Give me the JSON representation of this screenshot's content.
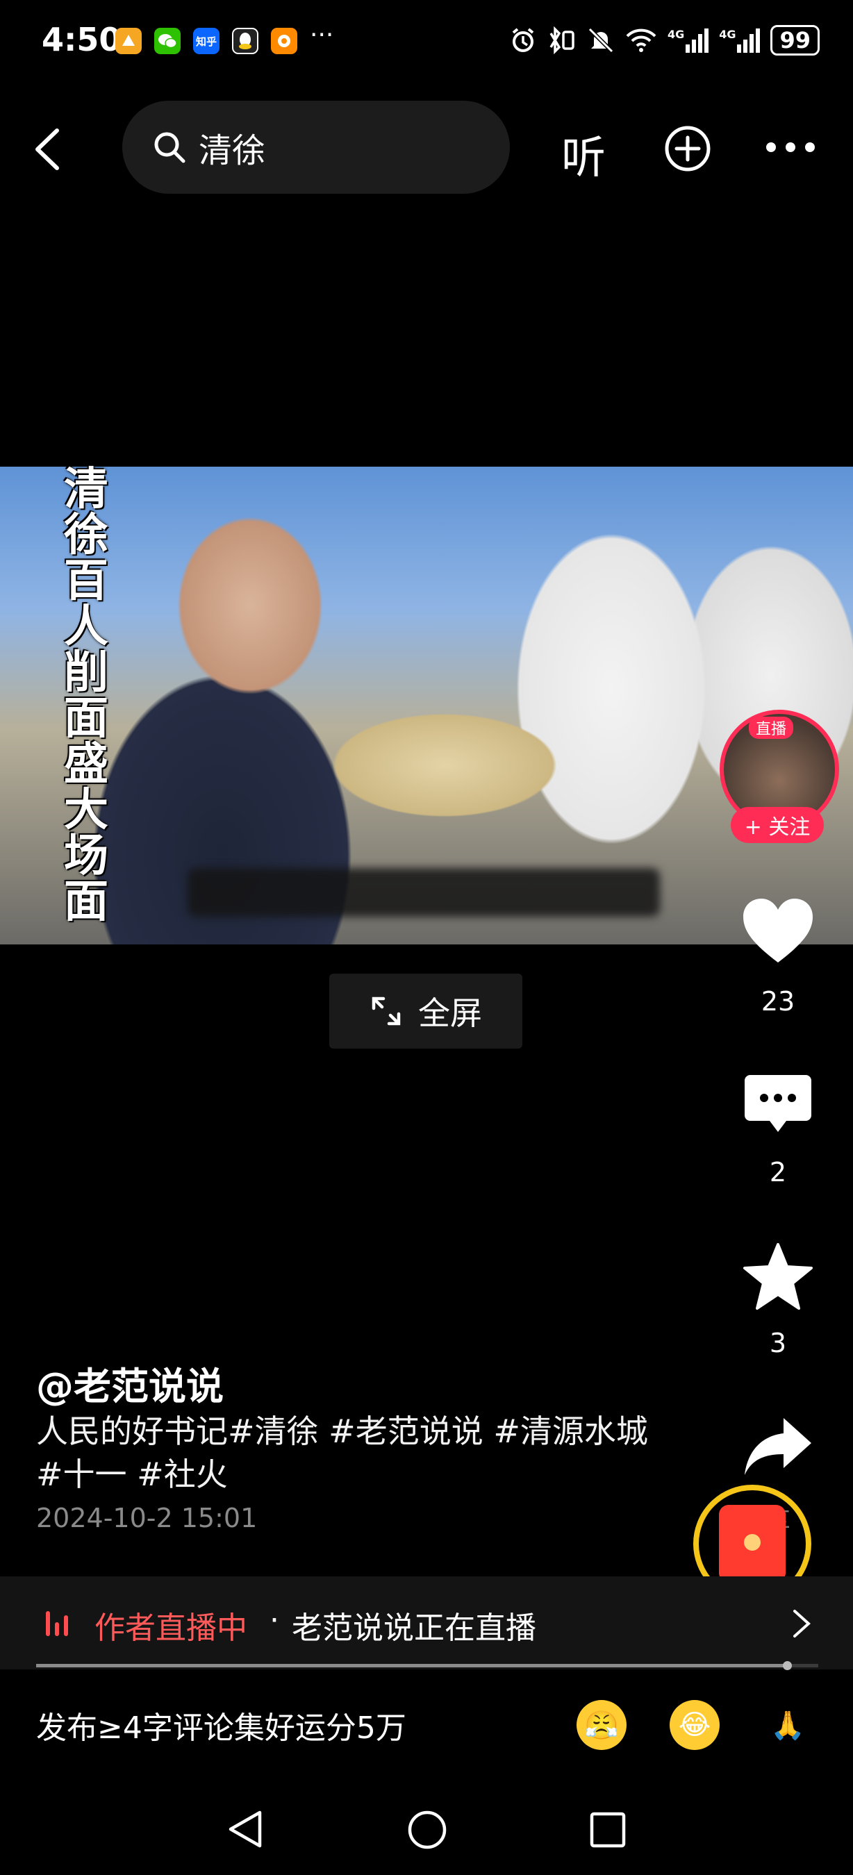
{
  "status_bar": {
    "time": "4:50",
    "apps": [
      {
        "name": "xiaoxiang-app-icon",
        "label": "",
        "color": "#f5a623"
      },
      {
        "name": "wechat-icon",
        "label": "",
        "color": "#2dc100"
      },
      {
        "name": "zhihu-icon",
        "label": "知乎",
        "color": "#0a66ff"
      },
      {
        "name": "qq-icon",
        "label": "",
        "color": "#222222"
      },
      {
        "name": "game-app-icon",
        "label": "",
        "color": "#ff8a00"
      }
    ],
    "overflow": "···",
    "signal_1": "4G",
    "signal_2": "4G",
    "battery": "99"
  },
  "top_nav": {
    "search_query": "清徐",
    "listen_label": "听"
  },
  "video": {
    "caption": "清徐百人削面盛大场面",
    "fullscreen_label": "全屏"
  },
  "live_avatar": {
    "tag": "直播",
    "follow_label": "+ 关注"
  },
  "actions": {
    "likes": "23",
    "comments": "2",
    "favorites": "3",
    "share_label": "分享"
  },
  "post": {
    "author": "@老范说说",
    "description": "人民的好书记#清徐 #老范说说 #清源水城 #十一 #社火",
    "date": "2024-10-2 15:01"
  },
  "live_banner": {
    "label": "作者直播中",
    "separator": "·",
    "text": "老范说说正在直播"
  },
  "progress": {
    "fraction": 0.96
  },
  "comment_bar": {
    "prompt": "发布≥4字评论集好运分5万",
    "emojis": [
      "😤",
      "😂",
      "🙏"
    ]
  },
  "colors": {
    "accent_red": "#ff2d55",
    "live_red": "#ff5a5a",
    "redpacket_ring": "#f5c518"
  }
}
